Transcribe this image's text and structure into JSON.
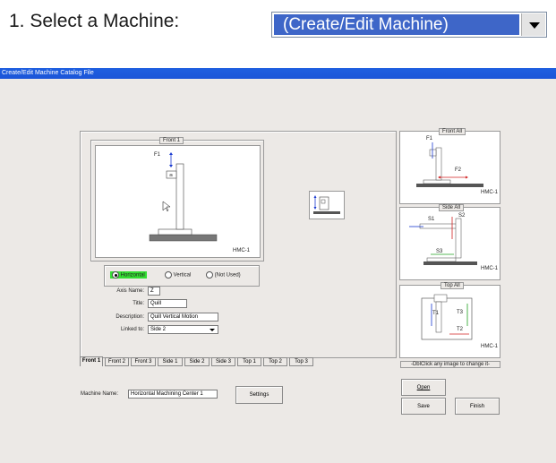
{
  "top": {
    "label": "1. Select a Machine:",
    "selected": "(Create/Edit Machine)"
  },
  "window": {
    "title": "Create/Edit Machine Catalog File"
  },
  "front_view": {
    "group": "Front 1",
    "axis_label": "F1",
    "machine_tag": "HMC-1",
    "orientation_options": [
      "Horizontal",
      "Vertical",
      "(Not Used)"
    ],
    "selected_orientation": "Horizontal"
  },
  "fields": {
    "axis_name_label": "Axis Name:",
    "axis_name": "Z",
    "title_label": "Title:",
    "title": "Quill",
    "description_label": "Description:",
    "description": "Quill Vertical Motion",
    "linked_label": "Linked to:",
    "linked": "Side 2"
  },
  "tabs": [
    "Front 1",
    "Front 2",
    "Front 3",
    "Side 1",
    "Side 2",
    "Side 3",
    "Top 1",
    "Top 2",
    "Top 3"
  ],
  "active_tab": "Front 1",
  "machine_name": {
    "label": "Machine Name:",
    "value": "Horizontal Machining Center 1"
  },
  "buttons": {
    "settings": "Settings",
    "open": "Open",
    "save": "Save",
    "finish": "Finish"
  },
  "thumbnails": {
    "front_all": {
      "title": "Front All",
      "labels": [
        "F1",
        "F2"
      ],
      "tag": "HMC-1"
    },
    "side_all": {
      "title": "Side All",
      "labels": [
        "S1",
        "S2",
        "S3"
      ],
      "tag": "HMC-1"
    },
    "top_all": {
      "title": "Top All",
      "labels": [
        "T1",
        "T3",
        "T2"
      ],
      "tag": "HMC-1"
    }
  },
  "hint": "-DblClick any image to change it-",
  "colors": {
    "selection": "#3e66c8",
    "titlebar": "#1f5fe0",
    "highlight": "#33dd33",
    "axis_arrow": "#1a3ad0",
    "red_arrow": "#d02020",
    "green_arrow": "#20a020"
  }
}
